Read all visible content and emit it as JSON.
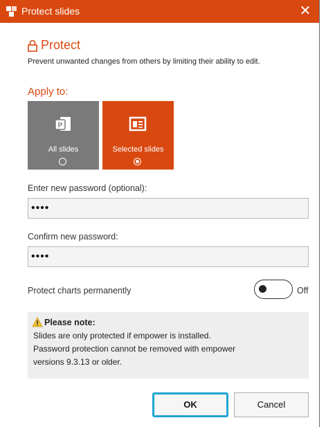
{
  "window": {
    "title": "Protect slides",
    "close_glyph": "✕",
    "app_icon": "app-icon",
    "title_bar_color": "#d9480f"
  },
  "protect": {
    "heading": "Protect",
    "heading_icon": "lock-icon",
    "description": "Prevent unwanted changes from others by limiting their ability to edit."
  },
  "apply_to": {
    "label": "Apply to:",
    "options": [
      {
        "label": "All slides",
        "icon": "presentation-icon",
        "selected": false
      },
      {
        "label": "Selected slides",
        "icon": "slide-icon",
        "selected": true
      }
    ]
  },
  "password": {
    "new_label": "Enter new password (optional):",
    "new_value": "••••",
    "confirm_label": "Confirm new password:",
    "confirm_value": "••••"
  },
  "charts": {
    "label": "Protect charts permanently",
    "state": "Off"
  },
  "note": {
    "icon": "warning-icon",
    "title": "Please note:",
    "lines": [
      "Slides are only protected if empower is installed.",
      "Password protection cannot be removed with empower",
      "versions 9.3.13 or older."
    ]
  },
  "buttons": {
    "ok": "OK",
    "cancel": "Cancel"
  },
  "colors": {
    "accent": "#d9480f",
    "tile_gray": "#7a7a7a",
    "focus_ring": "#1fa6d3"
  }
}
